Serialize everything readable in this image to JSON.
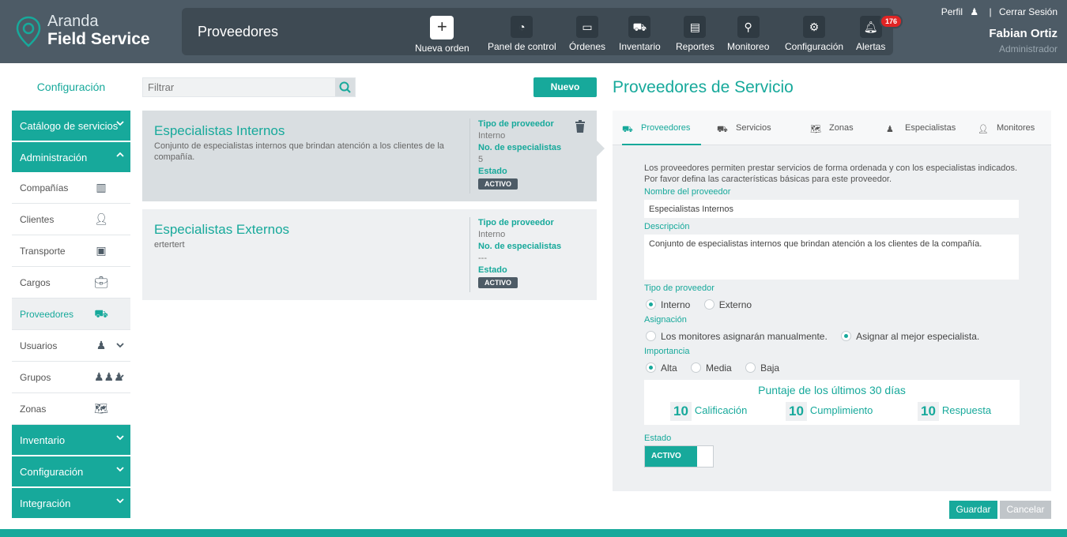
{
  "brand": {
    "line1": "Aranda",
    "line2": "Field Service"
  },
  "header": {
    "section_title": "Proveedores",
    "nav": [
      "Nueva orden",
      "Panel de control",
      "Órdenes",
      "Inventario",
      "Reportes",
      "Monitoreo",
      "Configuración",
      "Alertas"
    ],
    "alerts_count": "176",
    "profile_link": "Perfil",
    "separator": "|",
    "logout_link": "Cerrar Sesión",
    "user_name": "Fabian Ortiz",
    "user_role": "Administrador"
  },
  "sidebar": {
    "title": "Configuración",
    "sections": [
      "Catálogo de servicios",
      "Administración",
      "Inventario",
      "Configuración",
      "Integración"
    ],
    "admin_items": [
      "Compañías",
      "Clientes",
      "Transporte",
      "Cargos",
      "Proveedores",
      "Usuarios",
      "Grupos",
      "Zonas"
    ]
  },
  "list": {
    "filter_placeholder": "Filtrar",
    "new_button": "Nuevo",
    "type_label": "Tipo de proveedor",
    "count_label": "No. de especialistas",
    "status_label": "Estado",
    "items": [
      {
        "name": "Especialistas Internos",
        "description": "Conjunto de especialistas internos que brindan atención a los clientes de la compañía.",
        "type": "Interno",
        "count": "5",
        "status": "ACTIVO"
      },
      {
        "name": "Especialistas Externos",
        "description": "ertertert",
        "type": "Interno",
        "count": "---",
        "status": "ACTIVO"
      }
    ]
  },
  "detail": {
    "title": "Proveedores de Servicio",
    "tabs": [
      "Proveedores",
      "Servicios",
      "Zonas",
      "Especialistas",
      "Monitores"
    ],
    "intro": "Los proveedores permiten prestar servicios de forma ordenada y con los especialistas indicados. Por favor defina las características básicas para este proveedor.",
    "name_label": "Nombre del proveedor",
    "name_value": "Especialistas Internos",
    "desc_label": "Descripción",
    "desc_value": "Conjunto de especialistas internos que brindan atención a los clientes de la compañía.",
    "type_label": "Tipo de proveedor",
    "type_options": [
      "Interno",
      "Externo"
    ],
    "assign_label": "Asignación",
    "assign_options": [
      "Los monitores asignarán manualmente.",
      "Asignar al mejor especialista."
    ],
    "importance_label": "Importancia",
    "importance_options": [
      "Alta",
      "Media",
      "Baja"
    ],
    "score_title": "Puntaje de los últimos 30 días",
    "scores": [
      {
        "value": "10",
        "label": "Calificación"
      },
      {
        "value": "10",
        "label": "Cumplimiento"
      },
      {
        "value": "10",
        "label": "Respuesta"
      }
    ],
    "status_label": "Estado",
    "status_value": "ACTIVO",
    "save": "Guardar",
    "cancel": "Cancelar"
  },
  "colors": {
    "accent": "#17a99b",
    "header": "#4d5b66",
    "badge": "#e02424"
  }
}
